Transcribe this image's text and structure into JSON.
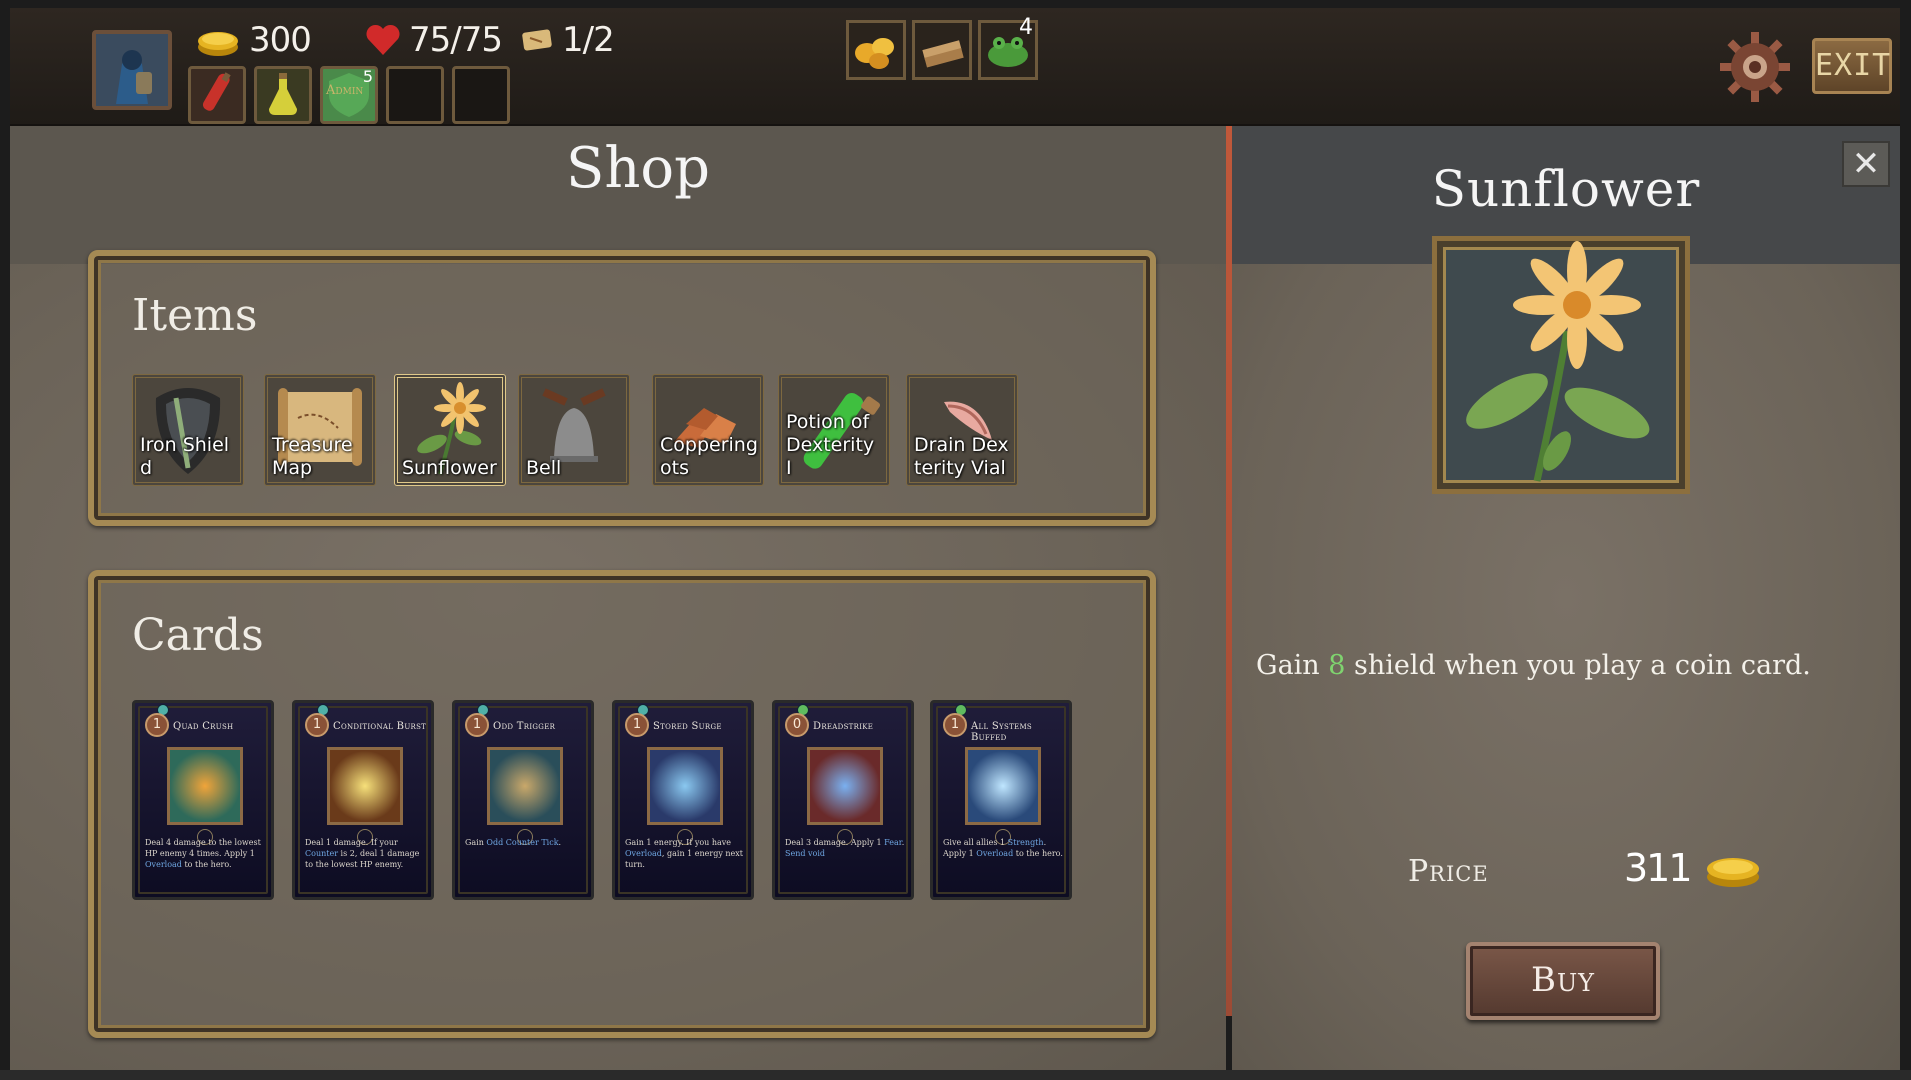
{
  "topbar": {
    "gold": "300",
    "health": "75/75",
    "map_progress": "1/2",
    "potion_slots": [
      {
        "icon": "red-potion-icon"
      },
      {
        "icon": "yellow-potion-icon"
      },
      {
        "icon": "admin-shield-icon",
        "label": "Admin",
        "count": "5"
      },
      {
        "icon": "empty"
      },
      {
        "icon": "empty"
      }
    ],
    "relics": [
      {
        "icon": "lemons-relic-icon",
        "count": ""
      },
      {
        "icon": "wood-planks-relic-icon",
        "count": ""
      },
      {
        "icon": "frog-relic-icon",
        "count": "4"
      }
    ],
    "exit_label": "EXIT"
  },
  "shop": {
    "title": "Shop",
    "items_heading": "Items",
    "items": [
      {
        "label": "Iron Shield",
        "icon": "iron-shield-icon"
      },
      {
        "label": "Treasure Map",
        "icon": "treasure-map-icon"
      },
      {
        "label": "Sunflower",
        "icon": "sunflower-icon"
      },
      {
        "label": "Bell",
        "icon": "bell-icon"
      },
      {
        "label": "Copperingots",
        "icon": "copper-ingots-icon"
      },
      {
        "label": "Potion of Dexterity I",
        "icon": "green-potion-icon"
      },
      {
        "label": "Drain Dexterity Vial",
        "icon": "drain-vial-icon"
      }
    ],
    "cards_heading": "Cards",
    "cards": [
      {
        "name": "Quad Crush",
        "cost": "1",
        "gem": "#4fb0a7",
        "text_parts": [
          "Deal ",
          "4",
          " damage to the lowest HP enemy ",
          "4",
          " times. Apply ",
          "1",
          " ",
          "Overload",
          " to the hero."
        ]
      },
      {
        "name": "Conditional Burst",
        "cost": "1",
        "gem": "#4fb0a7",
        "text_parts": [
          "Deal ",
          "1",
          " damage. If your ",
          "Counter",
          " is ",
          "2",
          ", deal ",
          "1",
          " damage to the lowest HP enemy."
        ]
      },
      {
        "name": "Odd Trigger",
        "cost": "1",
        "gem": "#4fb0a7",
        "text_parts": [
          "Gain ",
          "Odd Counter Tick",
          "."
        ]
      },
      {
        "name": "Stored Surge",
        "cost": "1",
        "gem": "#4fb0a7",
        "text_parts": [
          "Gain ",
          "1",
          " energy. If you have ",
          "Overload",
          ", gain ",
          "1",
          " energy next turn."
        ]
      },
      {
        "name": "Dreadstrike",
        "cost": "0",
        "gem": "#5fbb5f",
        "text_parts": [
          "Deal ",
          "3",
          " damage. Apply ",
          "1",
          " ",
          "Fear",
          ". ",
          "Send void",
          ""
        ]
      },
      {
        "name": "All Systems Buffed",
        "cost": "1",
        "gem": "#5fbb5f",
        "text_parts": [
          "Give all allies ",
          "1",
          " ",
          "Strength",
          ". Apply ",
          "1",
          " ",
          "Overload",
          " to the hero."
        ]
      }
    ]
  },
  "detail": {
    "title": "Sunflower",
    "desc_before": "Gain ",
    "desc_num": "8",
    "desc_after": " shield when you play a coin card.",
    "price_label": "Price",
    "price_value": "311",
    "buy_label": "Buy",
    "close_label": "✕"
  }
}
